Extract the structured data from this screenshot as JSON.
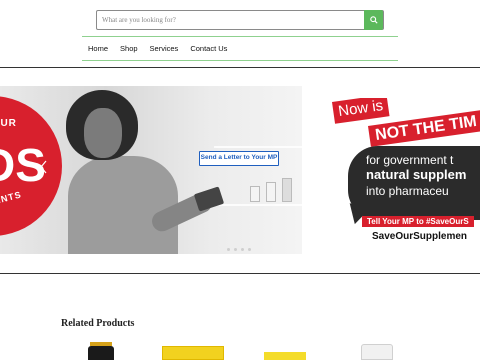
{
  "search": {
    "placeholder": "What are you looking for?",
    "icon": "search-icon",
    "button_color": "#5cb85c"
  },
  "nav": {
    "items": [
      {
        "label": "Home"
      },
      {
        "label": "Shop"
      },
      {
        "label": "Services"
      },
      {
        "label": "Contact Us"
      }
    ],
    "line_color": "#8fd18f"
  },
  "hero": {
    "badge_top": "YOUR",
    "badge_big": "DS",
    "badge_bottom": "EMENTS",
    "cta_label": "Send a Letter to Your MP",
    "accent": "#d8202d",
    "cta_color": "#1f5fbf",
    "slide_count": 4
  },
  "promo": {
    "now_is": "Now is",
    "not_the_time": "NOT THE TIM",
    "line1": "for government t",
    "line2": "natural supplem",
    "line3": "into pharmaceu",
    "tell_mp": "Tell Your MP to #SaveOurS",
    "hashtag": "SaveOurSupplemen"
  },
  "related": {
    "title": "Related Products",
    "products": [
      {
        "name": "product-dark-bottle",
        "color": "#1a1a1a",
        "cap": "#d6a21a"
      },
      {
        "name": "product-yellow-box",
        "color": "#f2d21f",
        "cap": "#e9c300"
      },
      {
        "name": "product-yellow-pack",
        "color": "#f4dc2a",
        "cap": "#f4dc2a"
      },
      {
        "name": "product-white-bottle",
        "color": "#f1f1f1",
        "cap": "#dcdcdc"
      }
    ]
  }
}
